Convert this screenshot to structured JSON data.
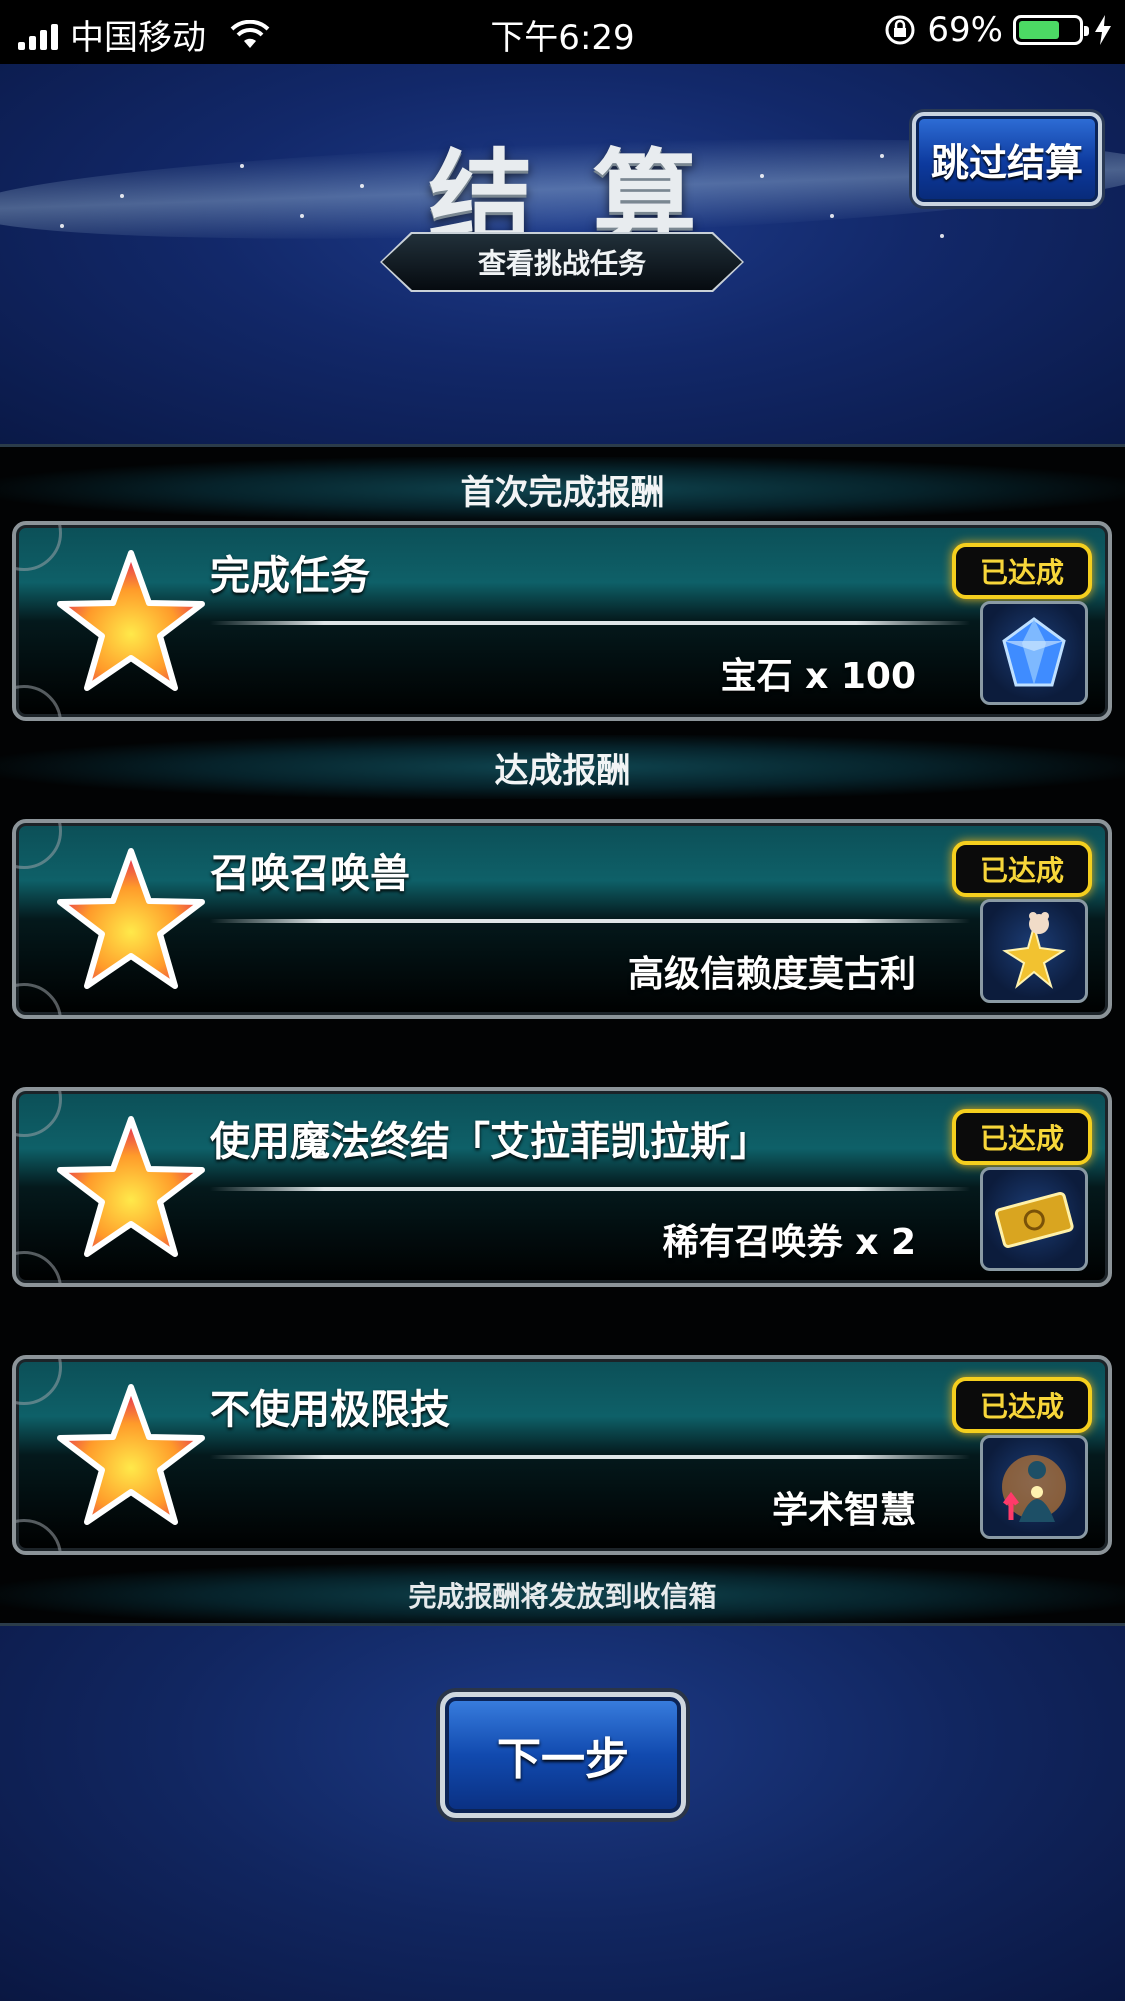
{
  "status_bar": {
    "carrier": "中国移动",
    "time": "下午6:29",
    "battery_percent": "69%",
    "battery_level": 0.69
  },
  "header": {
    "title": "结算",
    "view_tasks_label": "查看挑战任务",
    "skip_label": "跳过结算"
  },
  "sections": {
    "first_clear_title": "首次完成报酬",
    "achievement_title": "达成报酬",
    "footer_note": "完成报酬将发放到收信箱"
  },
  "badge_label": "已达成",
  "missions": [
    {
      "name": "完成任务",
      "reward": "宝石 x 100",
      "reward_icon": "gem-icon"
    },
    {
      "name": "召唤召唤兽",
      "reward": "高级信赖度莫古利",
      "reward_icon": "moogle-star-icon"
    },
    {
      "name": "使用魔法终结「艾拉菲凯拉斯」",
      "reward": "稀有召唤券 x 2",
      "reward_icon": "ticket-icon"
    },
    {
      "name": "不使用极限技",
      "reward": "学术智慧",
      "reward_icon": "wisdom-icon"
    }
  ],
  "next_label": "下一步",
  "colors": {
    "accent_gold": "#f5cf1e",
    "button_blue": "#114aaf",
    "card_teal": "#0e6068"
  }
}
